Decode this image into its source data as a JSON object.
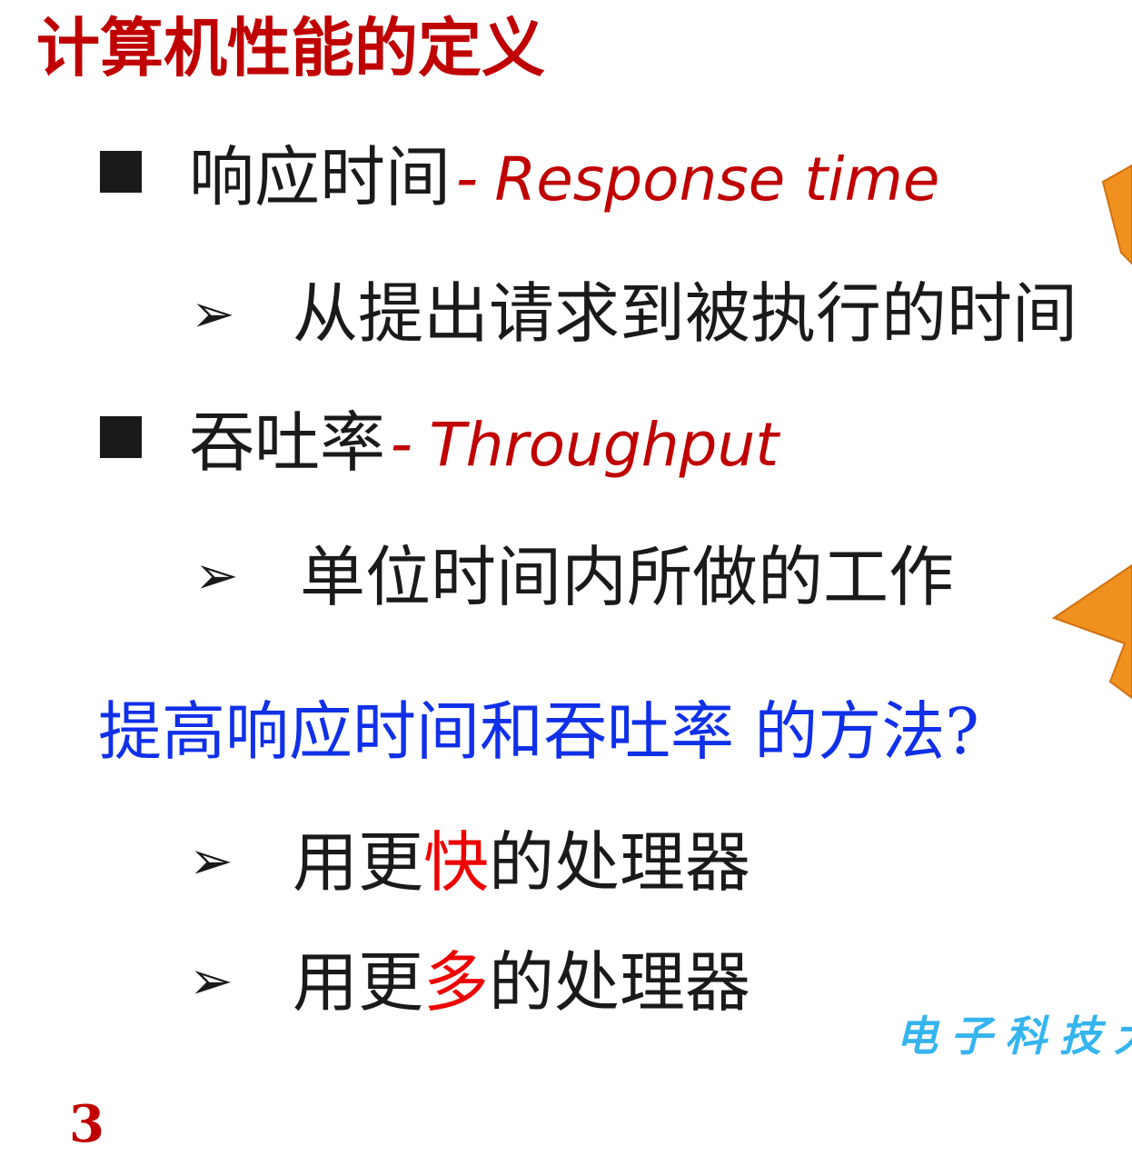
{
  "title": "计算机性能的定义",
  "bullets": [
    {
      "zh": "响应时间",
      "separator": "-",
      "en": "Response time",
      "sub": "从提出请求到被执行的时间"
    },
    {
      "zh": "吞吐率",
      "separator": "-",
      "en": "Throughput",
      "sub": "单位时间内所做的工作"
    }
  ],
  "question": "提高响应时间和吞吐率 的方法?",
  "answers": [
    {
      "before": "用更",
      "highlight": "快",
      "after": "的处理器"
    },
    {
      "before": "用更",
      "highlight": "多",
      "after": "的处理器"
    }
  ],
  "bullet_marker": "■",
  "arrow_marker": "➢",
  "watermark": "电子科技大",
  "page_number": "3",
  "colors": {
    "title": "#c00000",
    "question": "#1030e8",
    "highlight": "#ee0000",
    "watermark": "#35b4ee",
    "decoration": "#f0901e"
  }
}
